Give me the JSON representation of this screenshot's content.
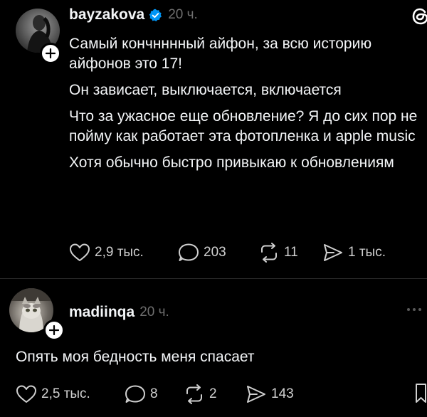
{
  "post": {
    "username": "bayzakova",
    "time": "20 ч.",
    "paragraphs": [
      "Самый кончнннный айфон, за всю историю айфонов это 17!",
      "Он зависает, выключается, включается",
      "Что за ужасное еще обновление? Я до сих пор не пойму как работает эта фотопленка и apple music",
      "Хотя обычно быстро привыкаю к обновлениям"
    ],
    "likes": "2,9 тыс.",
    "comments": "203",
    "reposts": "11",
    "shares": "1 тыс."
  },
  "reply": {
    "username": "madiinqa",
    "time": "20 ч.",
    "text": "Опять моя бедность меня спасает",
    "likes": "2,5 тыс.",
    "comments": "8",
    "reposts": "2",
    "shares": "143"
  },
  "icons": {
    "verified": "verified-badge-icon",
    "threads_logo": "threads-logo-icon",
    "follow": "plus-icon",
    "like": "heart-icon",
    "comment": "comment-bubble-icon",
    "repost": "repost-icon",
    "share": "send-icon",
    "more": "more-dots-icon",
    "bookmark": "bookmark-icon"
  },
  "colors": {
    "background": "#000000",
    "text": "#f3f5f7",
    "muted": "#6f6f6f",
    "verified": "#0095f6"
  }
}
